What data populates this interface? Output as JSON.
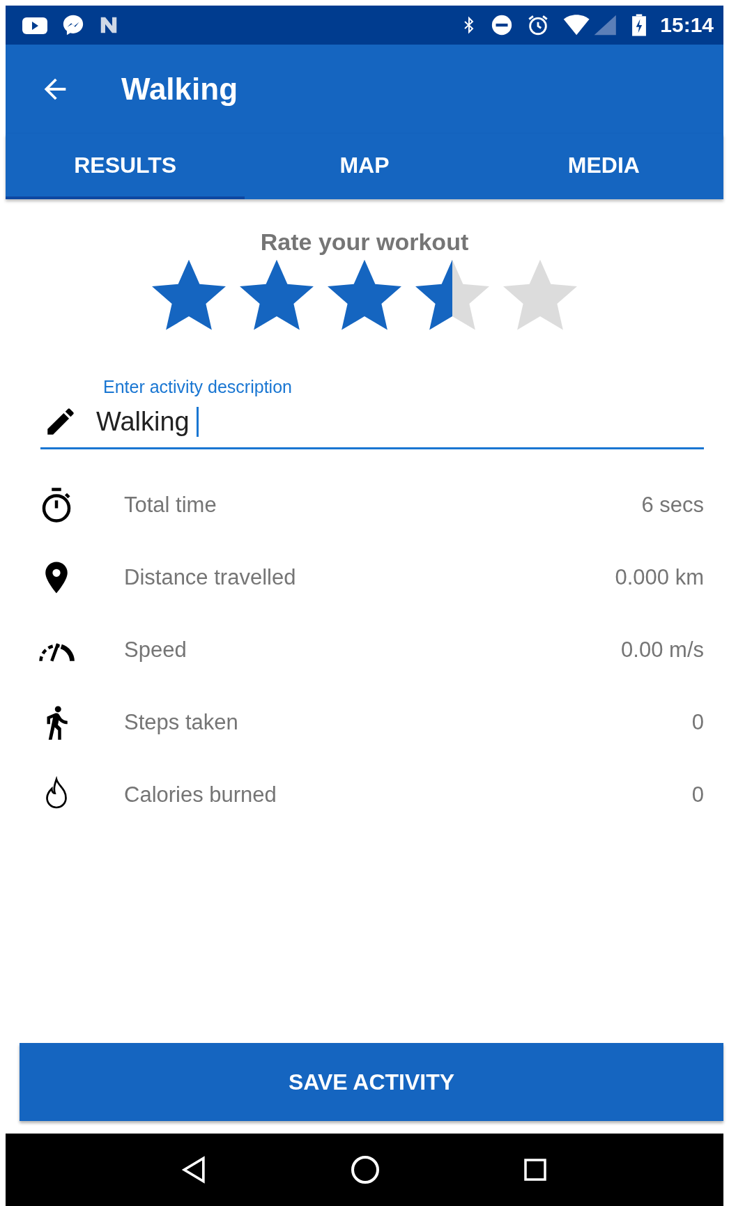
{
  "status_bar": {
    "time": "15:14"
  },
  "app_bar": {
    "title": "Walking"
  },
  "tabs": [
    {
      "label": "RESULTS",
      "selected": true
    },
    {
      "label": "MAP",
      "selected": false
    },
    {
      "label": "MEDIA",
      "selected": false
    }
  ],
  "rating": {
    "title": "Rate your workout",
    "stars": 3.5
  },
  "description": {
    "label": "Enter activity description",
    "value": "Walking"
  },
  "stats": [
    {
      "kind": "time",
      "label": "Total time",
      "value": "6 secs"
    },
    {
      "kind": "distance",
      "label": "Distance travelled",
      "value": "0.000 km"
    },
    {
      "kind": "speed",
      "label": "Speed",
      "value": "0.00 m/s"
    },
    {
      "kind": "steps",
      "label": "Steps taken",
      "value": "0"
    },
    {
      "kind": "calories",
      "label": "Calories burned",
      "value": "0"
    }
  ],
  "save_button": {
    "label": "SAVE ACTIVITY"
  }
}
